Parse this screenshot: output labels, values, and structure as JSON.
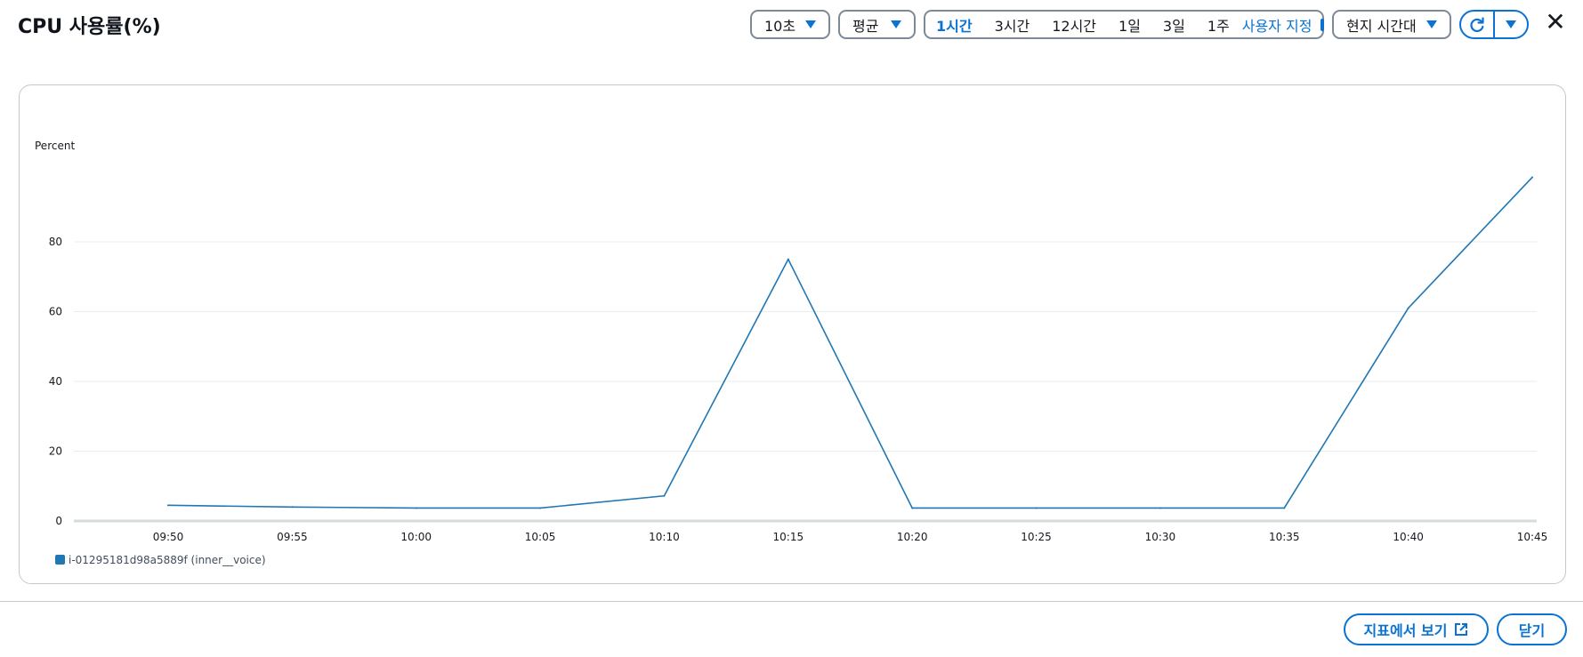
{
  "header": {
    "title": "CPU 사용률(%)",
    "period_value": "10초",
    "statistic_value": "평균",
    "ranges": [
      "1시간",
      "3시간",
      "12시간",
      "1일",
      "3일",
      "1주"
    ],
    "active_range": "1시간",
    "custom_label": "사용자 지정",
    "timezone_value": "현지 시간대",
    "close_label": "✕"
  },
  "footer": {
    "view_in_metrics": "지표에서 보기",
    "close": "닫기"
  },
  "chart_data": {
    "type": "line",
    "ylabel": "Percent",
    "xlabel": "",
    "title": "",
    "ylim": [
      0,
      100
    ],
    "y_ticks": [
      0,
      20,
      40,
      60,
      80
    ],
    "grid": true,
    "legend_position": "bottom-left",
    "x_ticks": [
      "09:50",
      "09:55",
      "10:00",
      "10:05",
      "10:10",
      "10:15",
      "10:20",
      "10:25",
      "10:30",
      "10:35",
      "10:40",
      "10:45"
    ],
    "series": [
      {
        "name": "i-01295181d98a5889f (inner__voice)",
        "color": "#1f77b4",
        "x": [
          "09:50",
          "09:55",
          "10:00",
          "10:05",
          "10:10",
          "10:15",
          "10:20",
          "10:25",
          "10:30",
          "10:35",
          "10:40",
          "10:45"
        ],
        "values": [
          4.5,
          4.0,
          3.7,
          3.7,
          7.2,
          75.0,
          3.7,
          3.7,
          3.7,
          3.7,
          61.0,
          98.5
        ]
      }
    ]
  },
  "colors": {
    "accent": "#0972d3",
    "series": "#1f77b4",
    "grid": "#eaeded",
    "axis": "#d5dbdb"
  }
}
